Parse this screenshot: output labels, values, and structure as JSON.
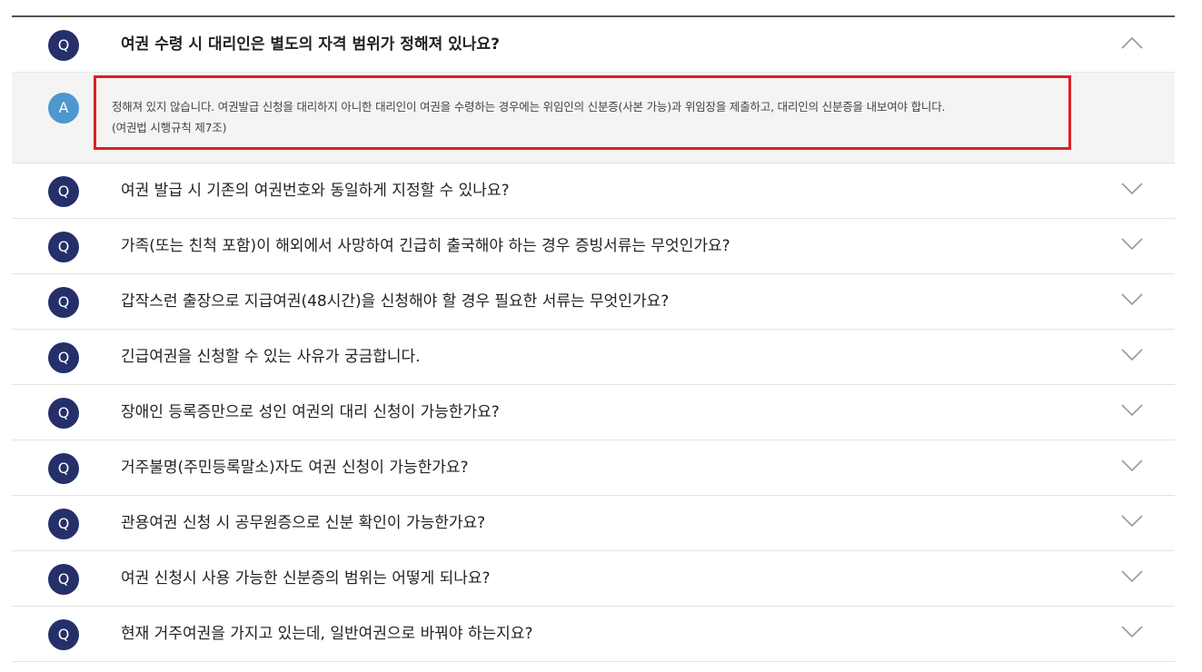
{
  "faq": {
    "q_badge": "Q",
    "a_badge": "A",
    "items": [
      {
        "question": "여권 수령 시 대리인은 별도의 자격 범위가 정해져 있나요?",
        "answer_line1": "정해져 있지 않습니다. 여권발급 신청을 대리하지 아니한 대리인이 여권을 수령하는 경우에는 위임인의 신분증(사본 가능)과 위임장을 제출하고, 대리인의 신분증을 내보여야 합니다.",
        "answer_line2": "(여권법 시행규칙 제7조)",
        "expanded": true
      },
      {
        "question": "여권 발급 시 기존의 여권번호와 동일하게 지정할 수 있나요?",
        "expanded": false
      },
      {
        "question": "가족(또는 친척 포함)이 해외에서 사망하여 긴급히 출국해야 하는 경우 증빙서류는 무엇인가요?",
        "expanded": false
      },
      {
        "question": "갑작스런 출장으로 지급여권(48시간)을 신청해야 할 경우 필요한 서류는 무엇인가요?",
        "expanded": false
      },
      {
        "question": "긴급여권을 신청할 수 있는 사유가 궁금합니다.",
        "expanded": false
      },
      {
        "question": "장애인 등록증만으로 성인 여권의 대리 신청이 가능한가요?",
        "expanded": false
      },
      {
        "question": "거주불명(주민등록말소)자도 여권 신청이 가능한가요?",
        "expanded": false
      },
      {
        "question": "관용여권 신청 시 공무원증으로 신분 확인이 가능한가요?",
        "expanded": false
      },
      {
        "question": "여권 신청시 사용 가능한 신분증의 범위는 어떻게 되나요?",
        "expanded": false
      },
      {
        "question": "현재 거주여권을 가지고 있는데, 일반여권으로 바꿔야 하는지요?",
        "expanded": false
      }
    ]
  },
  "icons": {
    "collapse": "chevron-up-icon",
    "expand": "chevron-down-icon"
  },
  "colors": {
    "q_badge": "#252f6a",
    "a_badge": "#4e97cf",
    "highlight_border": "#dd1f26",
    "answer_bg": "#f4f4f4"
  }
}
